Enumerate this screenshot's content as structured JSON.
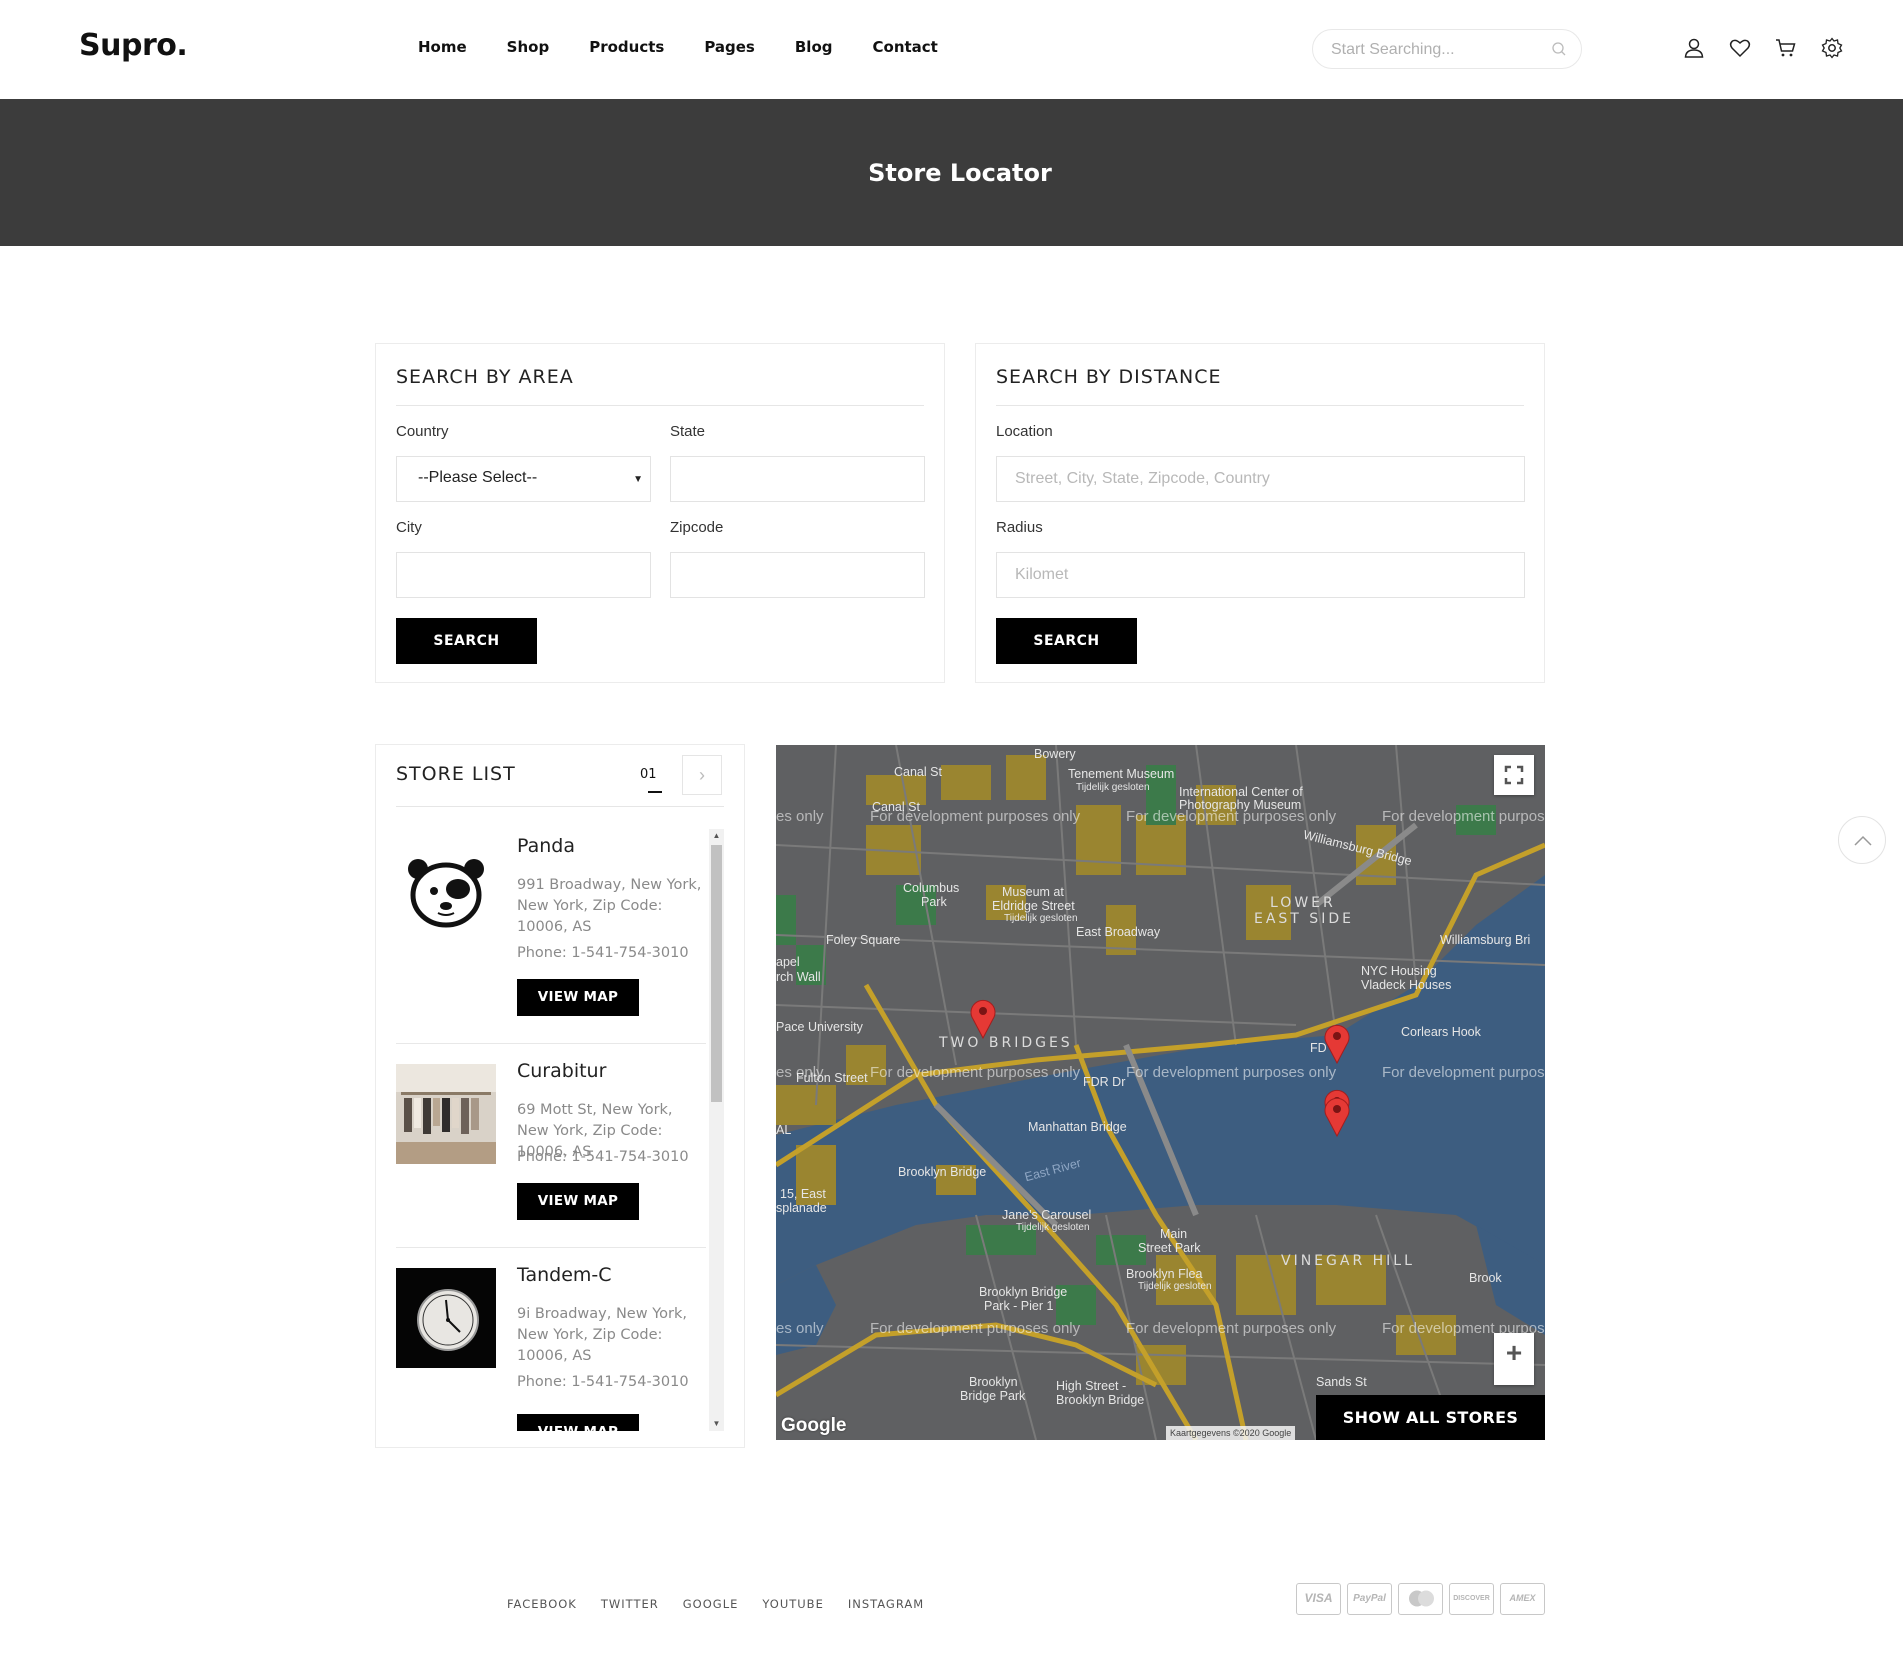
{
  "header": {
    "logo": "Supro.",
    "nav": [
      "Home",
      "Shop",
      "Products",
      "Pages",
      "Blog",
      "Contact"
    ],
    "search_placeholder": "Start Searching...",
    "icons": [
      "user-icon",
      "heart-icon",
      "cart-icon",
      "gear-icon"
    ]
  },
  "banner": {
    "title": "Store Locator"
  },
  "search_area": {
    "title": "SEARCH BY AREA",
    "country_label": "Country",
    "country_value": "--Please Select--",
    "state_label": "State",
    "city_label": "City",
    "zipcode_label": "Zipcode",
    "search_button": "SEARCH"
  },
  "search_distance": {
    "title": "SEARCH BY DISTANCE",
    "location_label": "Location",
    "location_placeholder": "Street, City, State, Zipcode, Country",
    "radius_label": "Radius",
    "radius_placeholder": "Kilomet",
    "search_button": "SEARCH"
  },
  "store_list": {
    "title": "STORE LIST",
    "page": "01",
    "next_icon": "chevron-right-icon",
    "stores": [
      {
        "name": "Panda",
        "address": "991 Broadway, New York, New York, Zip Code: 10006, AS",
        "phone": "Phone: 1-541-754-3010",
        "button": "VIEW MAP"
      },
      {
        "name": "Curabitur",
        "address": "69 Mott St, New York, New York, Zip Code: 10006, AS",
        "phone": "Phone: 1-541-754-3010",
        "button": "VIEW MAP"
      },
      {
        "name": "Tandem-C",
        "address": "9i Broadway, New York, New York, Zip Code: 10006, AS",
        "phone": "Phone: 1-541-754-3010",
        "button": "VIEW MAP"
      }
    ]
  },
  "map": {
    "show_all_button": "SHOW ALL STORES",
    "dev_watermark": "For development purposes only",
    "dev_watermark_left": "es only",
    "dev_watermark_right": "For development purpos",
    "attribution": "Kaartgegevens ©2020 Google",
    "google_logo": "Google",
    "zoom_in": "+",
    "labels": {
      "bowery": "Bowery",
      "canal_st": "Canal St",
      "canal_st_2": "Canal St",
      "tenement": "Tenement Museum",
      "tenement_sub": "Tijdelijk gesloten",
      "icp": "International Center of",
      "icp2": "Photography Museum",
      "williamsburg_bridge_road": "Williamsburg Bridge",
      "lower_east_side": "LOWER",
      "lower_east_side2": "EAST SIDE",
      "columbus_park": "Columbus",
      "columbus_park2": "Park",
      "museum_eldridge": "Museum at",
      "museum_eldridge2": "Eldridge Street",
      "museum_eldridge3": "Tijdelijk gesloten",
      "east_broadway": "East Broadway",
      "williamsburg_bri": "Williamsburg Bri",
      "foley_square": "Foley Square",
      "nyc_housing": "NYC Housing",
      "vladeck": "Vladeck Houses",
      "pace": "Pace University",
      "two_bridges": "TWO BRIDGES",
      "corlears": "Corlears Hook",
      "fulton": "Fulton Street",
      "manhattan_bridge": "Manhattan Bridge",
      "brooklyn_bridge": "Brooklyn Bridge",
      "east_river": "East River",
      "fifteen_east": "15, East",
      "esplanade": "splanade",
      "janes_carousel": "Jane's Carousel",
      "janes_sub": "Tijdelijk gesloten",
      "main_street_park": "Main",
      "main_street_park2": "Street Park",
      "vinegar_hill": "VINEGAR HILL",
      "brooklyn_flea": "Brooklyn Flea",
      "brooklyn_flea_sub": "Tijdelijk gesloten",
      "bb_park_pier": "Brooklyn Bridge",
      "bb_park_pier2": "Park - Pier 1",
      "bb_park": "Brooklyn",
      "bb_park2": "Bridge Park",
      "high_street": "High Street -",
      "high_street2": "Brooklyn Bridge",
      "sands_st": "Sands St",
      "brook": "Brook",
      "apel": "apel",
      "rch_wall": "rch Wall",
      "al": "AL",
      "fdr": "FD",
      "fdr_dr": "FDR Dr"
    }
  },
  "footer": {
    "links": [
      "FACEBOOK",
      "TWITTER",
      "GOOGLE",
      "YOUTUBE",
      "INSTAGRAM"
    ],
    "payments": [
      "VISA",
      "PayPal",
      "",
      "DISCOVER",
      "AMEX"
    ]
  },
  "colors": {
    "accent": "#000000",
    "banner": "#3c3c3c",
    "map_water": "#3d5d80",
    "map_land": "#5f6062",
    "map_block": "#9a8530",
    "map_park": "#3c7a4a",
    "pin": "#e53935"
  }
}
